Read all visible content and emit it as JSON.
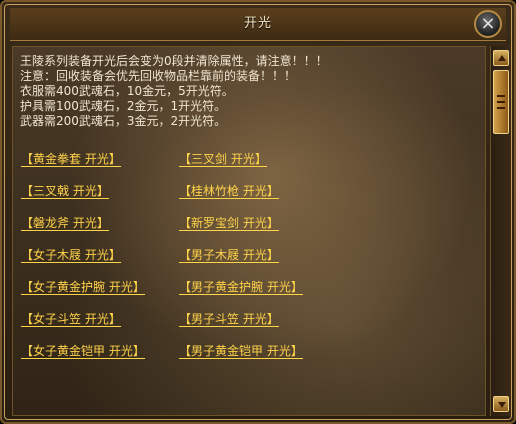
{
  "window": {
    "title": "开光"
  },
  "notice": {
    "lines": [
      "王陵系列装备开光后会变为0段并清除属性，请注意！！！",
      "注意：回收装备会优先回收物品栏靠前的装备！！！",
      "衣服需400武魂石，10金元，5开光符。",
      "护具需100武魂石，2金元，1开光符。",
      "武器需200武魂石，3金元，2开光符。"
    ]
  },
  "links": {
    "left": [
      "黄金拳套 开光",
      "三叉戟 开光",
      "磐龙斧 开光",
      "女子木屐 开光",
      "女子黄金护腕 开光",
      "女子斗笠 开光",
      "女子黄金铠甲 开光"
    ],
    "right": [
      "三叉剑 开光",
      "桂林竹枪 开光",
      "新罗宝剑 开光",
      "男子木屐 开光",
      "男子黄金护腕 开光",
      "男子斗笠 开光",
      "男子黄金铠甲 开光"
    ]
  },
  "icons": {
    "close": "close-icon",
    "scroll_up": "triangle-up-icon",
    "scroll_down": "triangle-down-icon"
  },
  "colors": {
    "link": "#ffd34a",
    "text": "#f0e6d1",
    "frame_gold": "#c9a15b"
  }
}
